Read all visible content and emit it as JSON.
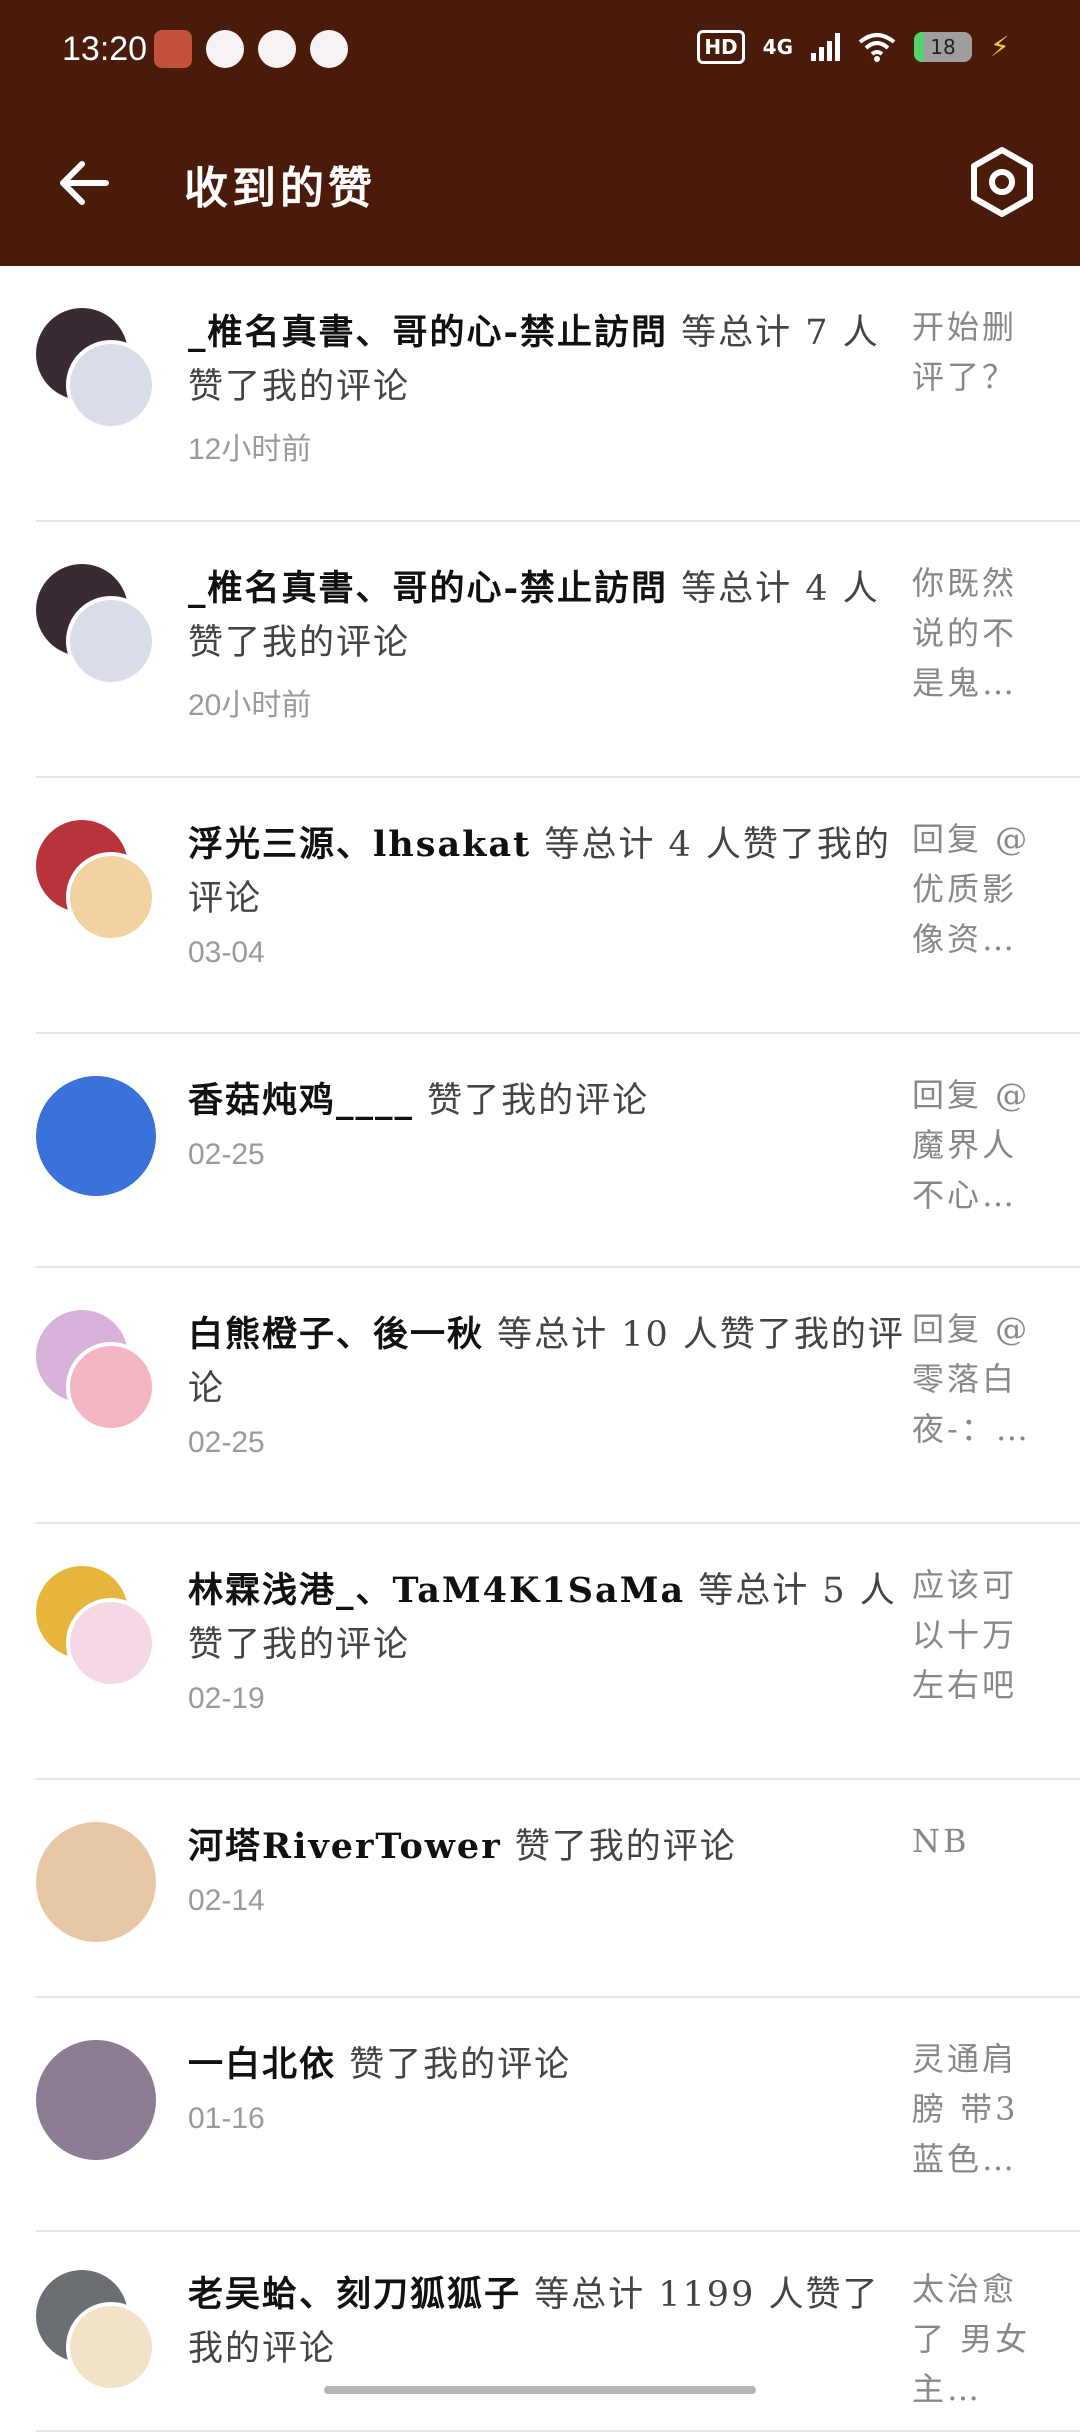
{
  "status_bar": {
    "time": "13:20",
    "hd": "HD",
    "network": "4G",
    "battery": "18",
    "battery_level_percent": 18,
    "notification_icons": [
      "game-app-icon",
      "bird-app-icon",
      "speed-app-icon",
      "play-app-icon"
    ]
  },
  "header": {
    "title": "收到的赞",
    "back_icon": "arrow-left-icon",
    "settings_icon": "hexagon-settings-icon",
    "background": "#4a1a0b"
  },
  "items": [
    {
      "names": "_椎名真書、哥的心-禁止訪問",
      "suffix": " 等总计 7 人赞了我的评论",
      "time": "12小时前",
      "preview": "开始删评了？",
      "avatar_colors": [
        "#3a2a33",
        "#d9dde8"
      ]
    },
    {
      "names": "_椎名真書、哥的心-禁止訪問",
      "suffix": " 等总计 4 人赞了我的评论",
      "time": "20小时前",
      "preview": "你既然说的不是鬼…",
      "avatar_colors": [
        "#3a2a33",
        "#d9dde8"
      ]
    },
    {
      "names": "浮光三源、lhsakat",
      "suffix": " 等总计 4 人赞了我的评论",
      "time": "03-04",
      "preview": "回复 @优质影像资…",
      "avatar_colors": [
        "#b9343a",
        "#f2d2a0"
      ]
    },
    {
      "names": "香菇炖鸡____",
      "suffix": " 赞了我的评论",
      "time": "02-25",
      "preview": "回复 @魔界人不心…",
      "avatar_colors": [
        "#3b72d9"
      ]
    },
    {
      "names": "白熊橙子、後一秋",
      "suffix": " 等总计 10 人赞了我的评论",
      "time": "02-25",
      "preview": "回复 @零落白夜-：…",
      "avatar_colors": [
        "#d8b2d8",
        "#f4b6c2"
      ]
    },
    {
      "names": "林霖浅港_、TaM4K1SaMa",
      "suffix": " 等总计 5 人赞了我的评论",
      "time": "02-19",
      "preview": "应该可以十万左右吧",
      "avatar_colors": [
        "#e7b53b",
        "#f5d8e6"
      ]
    },
    {
      "names": "河塔RiverTower",
      "suffix": " 赞了我的评论",
      "time": "02-14",
      "preview": "NB",
      "avatar_colors": [
        "#e8c7a6"
      ]
    },
    {
      "names": "一白北依",
      "suffix": " 赞了我的评论",
      "time": "01-16",
      "preview": "灵通肩膀 带3蓝色…",
      "avatar_colors": [
        "#8c7d93"
      ]
    },
    {
      "names": "老吴蛤、刻刀狐狐子",
      "suffix": " 等总计 1199 人赞了我的评论",
      "time": "",
      "preview": "太治愈了 男女主…",
      "avatar_colors": [
        "#6b6f73",
        "#f2e2c9"
      ]
    }
  ]
}
